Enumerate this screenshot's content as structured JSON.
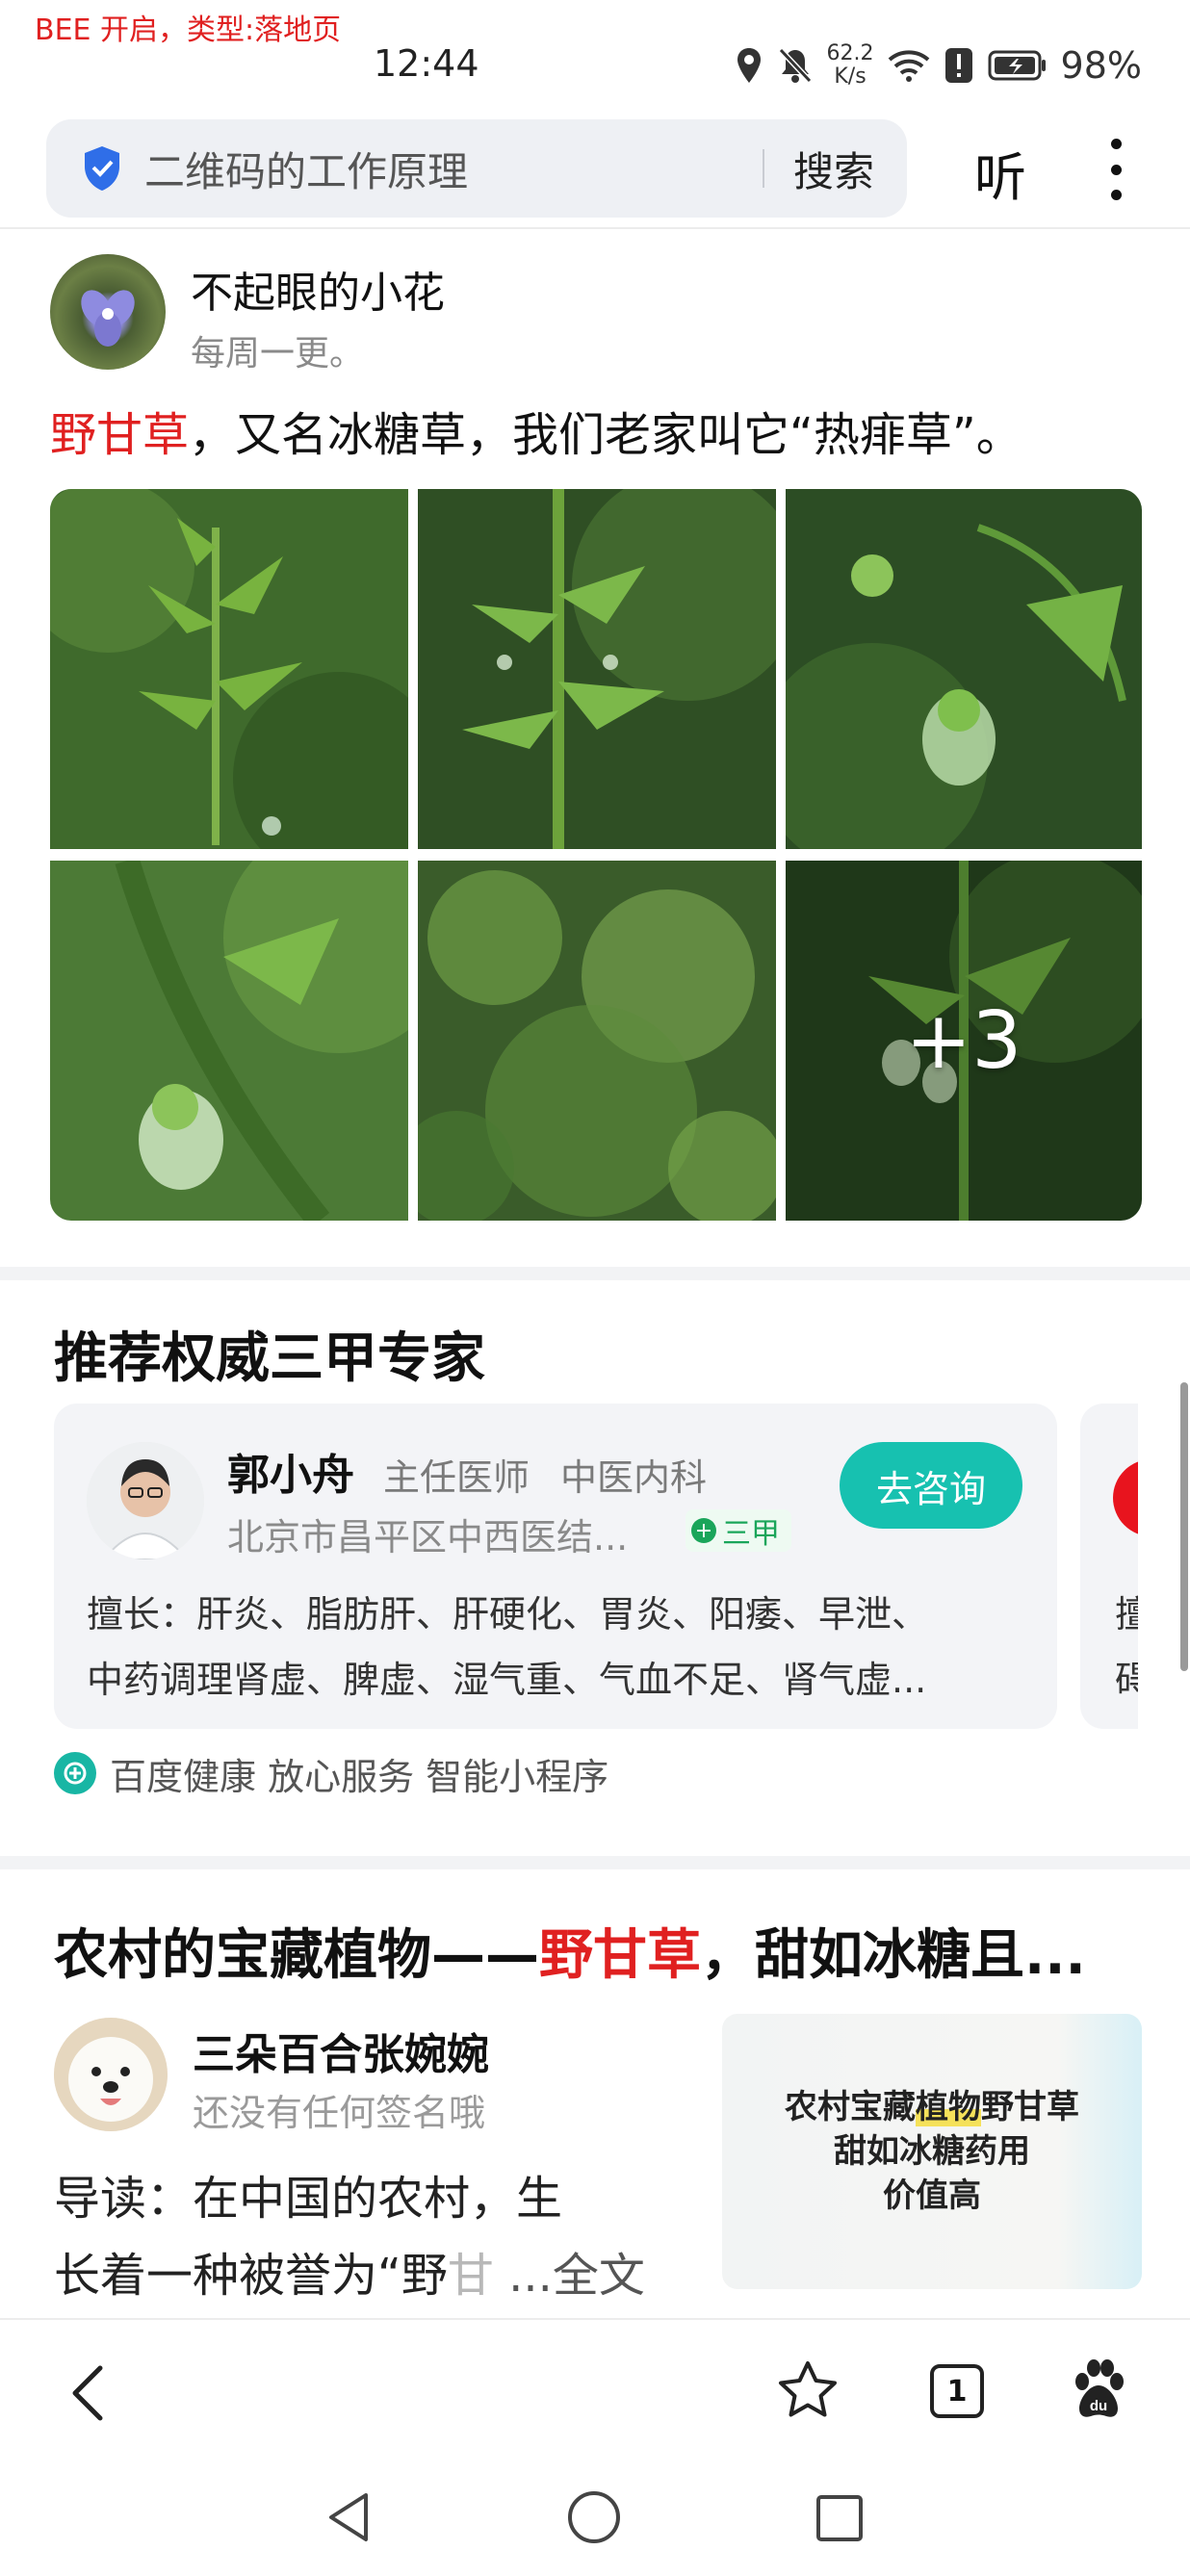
{
  "debug": {
    "label": "BEE 开启，类型:落地页"
  },
  "status_bar": {
    "time": "12:44",
    "net_speed_value": "62.2",
    "net_speed_unit": "K/s",
    "battery": "98%"
  },
  "search": {
    "query": "二维码的工作原理",
    "button_label": "搜索",
    "listen_label": "听"
  },
  "post": {
    "author": "不起眼的小花",
    "motto": "每周一更。",
    "text_highlight": "野甘草",
    "text_rest": "，又名冰糖草，我们老家叫它“热痱草”。",
    "more_count": "+3"
  },
  "experts": {
    "section_title": "推荐权威三甲专家",
    "doctor": {
      "name": "郭小舟",
      "role": "主任医师",
      "dept": "中医内科",
      "hospital": "北京市昌平区中西医结...",
      "badge": "三甲",
      "consult_label": "去咨询",
      "skills_line1": "擅长：肝炎、脂肪肝、肝硬化、胃炎、阳痿、早泄、",
      "skills_line2": "中药调理肾虚、脾虚、湿气重、气血不足、肾气虚..."
    },
    "peek": {
      "line1": "擅",
      "line2": "碍"
    },
    "footer": "百度健康 放心服务 智能小程序"
  },
  "article": {
    "title_pre": "农村的宝藏植物——",
    "title_highlight": "野甘草",
    "title_post": "，甜如冰糖且...",
    "author": "三朵百合张婉婉",
    "motto": "还没有任何签名哦",
    "intro_line1": "导读：在中国的农村，生",
    "intro_line2": "长着一种被誉为“野",
    "intro_fade": "甘",
    "intro_more": " ...全文",
    "thumb_line1_pre": "农村宝藏",
    "thumb_line1_hl": "植物",
    "thumb_line1_post": "野甘草",
    "thumb_line2": "甜如冰糖药用",
    "thumb_line3": "价值高"
  },
  "bottom_nav": {
    "tabs_count": "1"
  },
  "colors": {
    "highlight_red": "#e02020",
    "consult_teal": "#17c1b0",
    "badge_green": "#1aa55a"
  }
}
